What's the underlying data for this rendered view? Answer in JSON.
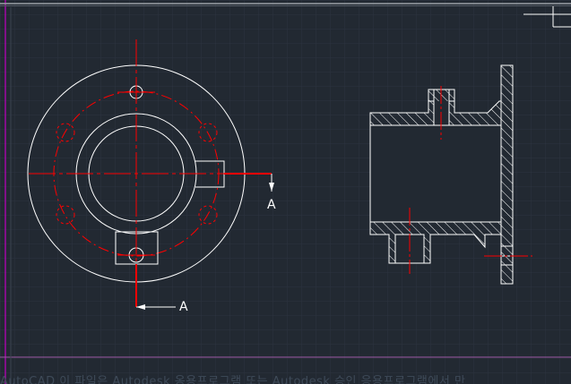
{
  "viewport": {
    "background_color": "#222932",
    "grid_color": "#2c3440",
    "object_color": "#ffffff",
    "centerline_color": "#ff0000",
    "layout_border_color": "#c000c0"
  },
  "annotations": {
    "section_label_right": "A",
    "section_label_bottom": "A"
  },
  "status": {
    "watermark_text": "AutoCAD    이 파일은 Autodesk 옹용프로그램 또는 Autodesk 승인 응용프로그램에서 만"
  },
  "icons": {
    "ucs": "ucs-icon"
  }
}
